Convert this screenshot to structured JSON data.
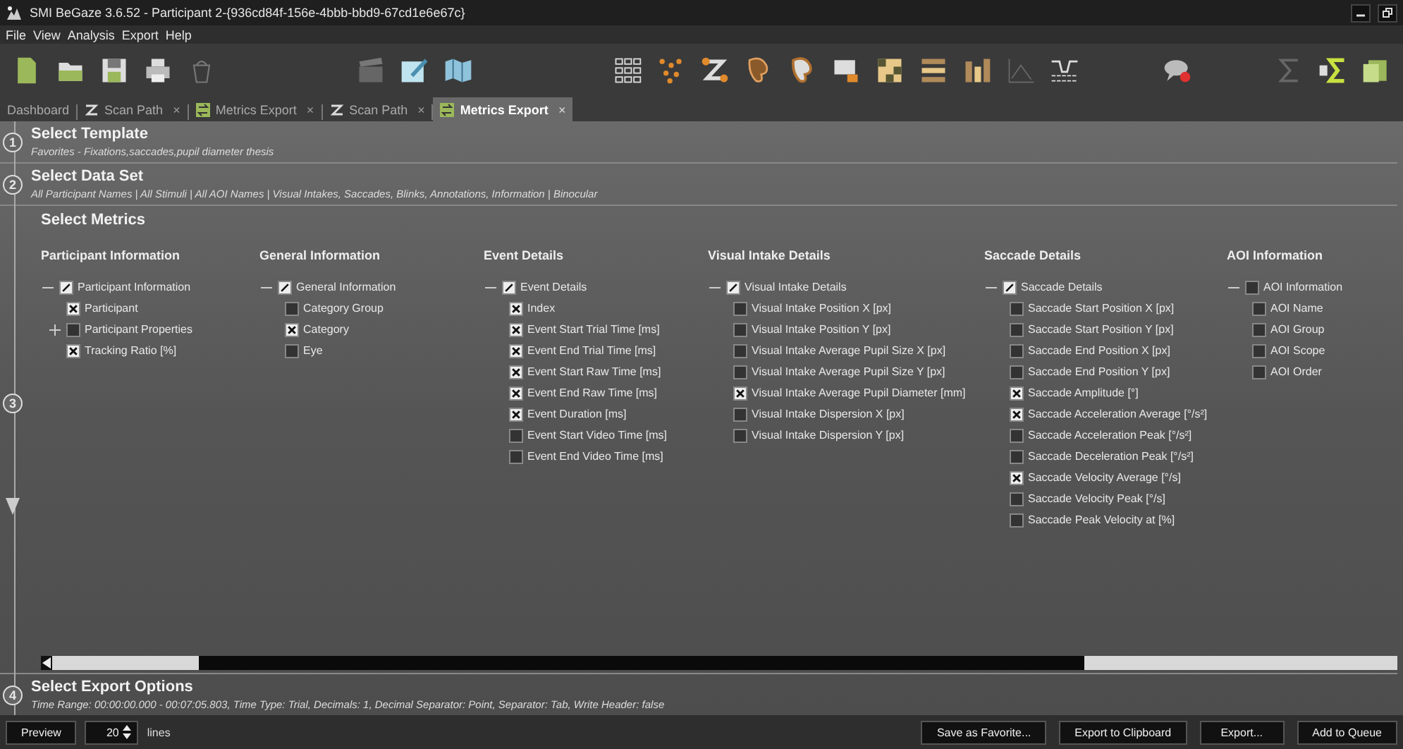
{
  "window": {
    "title": "SMI BeGaze 3.6.52 - Participant 2-{936cd84f-156e-4bbb-bbd9-67cd1e6e67c}"
  },
  "menu": [
    "File",
    "View",
    "Analysis",
    "Export",
    "Help"
  ],
  "tabs": [
    {
      "label": "Dashboard",
      "kind": "plain",
      "selected": false
    },
    {
      "label": "Scan Path",
      "kind": "scanpath",
      "close": "×",
      "selected": false
    },
    {
      "label": "Metrics Export",
      "kind": "metrics",
      "close": "×",
      "selected": false
    },
    {
      "label": "Scan Path",
      "kind": "scanpath",
      "close": "×",
      "selected": false
    },
    {
      "label": "Metrics Export",
      "kind": "metrics",
      "close": "×",
      "selected": true
    }
  ],
  "steps": [
    {
      "number": "1",
      "title": "Select Template",
      "summary": "Favorites - Fixations,saccades,pupil diameter thesis"
    },
    {
      "number": "2",
      "title": "Select Data Set",
      "summary": "All Participant Names | All Stimuli | All AOI Names | Visual Intakes, Saccades, Blinks, Annotations, Information | Binocular"
    },
    {
      "number": "3",
      "title": "Select Metrics"
    }
  ],
  "metric_groups": [
    {
      "heading": "Participant Information",
      "tree": [
        {
          "label": "Participant Information",
          "partial": true,
          "expanded": true,
          "children": [
            {
              "label": "Participant",
              "checked": true
            },
            {
              "label": "Participant Properties",
              "checked": false,
              "expanded": false
            },
            {
              "label": "Tracking Ratio [%]",
              "checked": true
            }
          ]
        }
      ]
    },
    {
      "heading": "General Information",
      "tree": [
        {
          "label": "General Information",
          "partial": true,
          "expanded": true,
          "children": [
            {
              "label": "Category Group",
              "checked": false
            },
            {
              "label": "Category",
              "checked": true
            },
            {
              "label": "Eye",
              "checked": false
            }
          ]
        }
      ]
    },
    {
      "heading": "Event Details",
      "tree": [
        {
          "label": "Event Details",
          "partial": true,
          "expanded": true,
          "children": [
            {
              "label": "Index",
              "checked": true
            },
            {
              "label": "Event Start Trial Time [ms]",
              "checked": true
            },
            {
              "label": "Event End Trial Time [ms]",
              "checked": true
            },
            {
              "label": "Event Start Raw Time [ms]",
              "checked": true
            },
            {
              "label": "Event End Raw Time [ms]",
              "checked": true
            },
            {
              "label": "Event Duration [ms]",
              "checked": true
            },
            {
              "label": "Event Start Video Time [ms]",
              "checked": false
            },
            {
              "label": "Event End Video Time [ms]",
              "checked": false
            }
          ]
        }
      ]
    },
    {
      "heading": "Visual Intake Details",
      "tree": [
        {
          "label": "Visual Intake Details",
          "partial": true,
          "expanded": true,
          "children": [
            {
              "label": "Visual Intake Position X [px]",
              "checked": false
            },
            {
              "label": "Visual Intake Position Y [px]",
              "checked": false
            },
            {
              "label": "Visual Intake Average Pupil Size X [px]",
              "checked": false
            },
            {
              "label": "Visual Intake Average Pupil Size Y [px]",
              "checked": false
            },
            {
              "label": "Visual Intake Average Pupil Diameter [mm]",
              "checked": true
            },
            {
              "label": "Visual Intake Dispersion X [px]",
              "checked": false
            },
            {
              "label": "Visual Intake Dispersion Y [px]",
              "checked": false
            }
          ]
        }
      ]
    },
    {
      "heading": "Saccade Details",
      "tree": [
        {
          "label": "Saccade Details",
          "partial": true,
          "expanded": true,
          "children": [
            {
              "label": "Saccade Start Position X [px]",
              "checked": false
            },
            {
              "label": "Saccade Start Position Y [px]",
              "checked": false
            },
            {
              "label": "Saccade End Position X [px]",
              "checked": false
            },
            {
              "label": "Saccade End Position Y [px]",
              "checked": false
            },
            {
              "label": "Saccade Amplitude [°]",
              "checked": true
            },
            {
              "label": "Saccade Acceleration Average [°/s²]",
              "checked": true
            },
            {
              "label": "Saccade Acceleration Peak [°/s²]",
              "checked": false
            },
            {
              "label": "Saccade Deceleration Peak [°/s²]",
              "checked": false
            },
            {
              "label": "Saccade Velocity Average [°/s]",
              "checked": true
            },
            {
              "label": "Saccade Velocity Peak [°/s]",
              "checked": false
            },
            {
              "label": "Saccade Peak Velocity at [%]",
              "checked": false
            }
          ]
        }
      ]
    },
    {
      "heading": "AOI Information",
      "tree": [
        {
          "label": "AOI Information",
          "checked": false,
          "partial": false,
          "expanded": true,
          "children": [
            {
              "label": "AOI Name",
              "checked": false
            },
            {
              "label": "AOI Group",
              "checked": false
            },
            {
              "label": "AOI Scope",
              "checked": false
            },
            {
              "label": "AOI Order",
              "checked": false
            }
          ]
        }
      ]
    }
  ],
  "export_options": {
    "number": "4",
    "title": "Select Export Options",
    "summary": "Time Range: 00:00:00.000 - 00:07:05.803, Time Type: Trial, Decimals: 1, Decimal Separator: Point, Separator: Tab, Write Header: false"
  },
  "footer": {
    "preview": "Preview",
    "lines_value": "20",
    "lines_label": "lines",
    "buttons": [
      "Save as Favorite...",
      "Export to Clipboard",
      "Export...",
      "Add to Queue"
    ]
  }
}
